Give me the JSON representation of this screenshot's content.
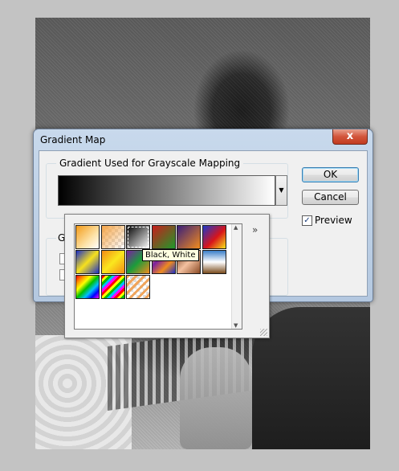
{
  "dialog": {
    "title": "Gradient Map",
    "close_label": "x",
    "group_label": "Gradient Used for Grayscale Mapping",
    "ok_label": "OK",
    "cancel_label": "Cancel",
    "preview_label": "Preview",
    "preview_checked": true,
    "options_group_partial_label": "G"
  },
  "picker": {
    "more_label": "»",
    "tooltip": "Black, White",
    "presets": [
      {
        "name": "orange-white",
        "css": "linear-gradient(135deg,#f39b1a 0%,#fde2a6 60%,#ffffff 100%)"
      },
      {
        "name": "orange-transparent",
        "css": "linear-gradient(135deg,#f5a64a 0%,rgba(245,166,74,0) 100%),repeating-conic-gradient(#ddd 0 25%,#fff 0 50%) 0 0/8px 8px"
      },
      {
        "name": "black-white",
        "css": "linear-gradient(135deg,#000 0%,#fff 100%)"
      },
      {
        "name": "red-green",
        "css": "linear-gradient(135deg,#c81d1d 0%,#1e9a2a 100%)"
      },
      {
        "name": "violet-orange",
        "css": "linear-gradient(135deg,#3a1f7a 0%,#f08b1e 100%)"
      },
      {
        "name": "blue-red-yellow",
        "css": "linear-gradient(135deg,#1b3acb 0%,#d8141a 55%,#f6e31a 100%)"
      },
      {
        "name": "blue-yellow-blue",
        "css": "linear-gradient(135deg,#1b2ec9 0%,#f6e11d 50%,#1b2ec9 100%)"
      },
      {
        "name": "orange-yellow-orange",
        "css": "linear-gradient(135deg,#f48b16 0%,#fae71e 50%,#f48b16 100%)"
      },
      {
        "name": "violet-green-orange",
        "css": "linear-gradient(135deg,#7b1fa2 0%,#1b9c3a 50%,#f08b1e 100%)"
      },
      {
        "name": "yellow-violet-orange-blue",
        "css": "linear-gradient(135deg,#f3e31a 0%,#7b1fa2 33%,#f08b1e 66%,#1b2ec9 100%)"
      },
      {
        "name": "copper",
        "css": "linear-gradient(135deg,#6b3317 0%,#f4c1a0 50%,#8a4a25 100%)"
      },
      {
        "name": "chrome",
        "css": "linear-gradient(180deg,#3b7fc9 0%,#ffffff 50%,#7a4c1e 100%)"
      },
      {
        "name": "spectrum",
        "css": "linear-gradient(135deg,#ff0000 0%,#ff8c00 17%,#ffff00 33%,#00c000 50%,#00bfff 67%,#0000ff 83%,#ff00ff 100%)"
      },
      {
        "name": "transparent-rainbow",
        "css": "repeating-linear-gradient(135deg,#ff0000 0 3px,#ffff00 3px 6px,#00c000 6px 9px,#00bfff 9px 12px,#ff00ff 12px 15px)"
      },
      {
        "name": "transparent-stripes",
        "css": "repeating-linear-gradient(135deg,#f0a45a 0 3px,rgba(255,255,255,0) 3px 7px),repeating-conic-gradient(#ddd 0 25%,#fff 0 50%) 0 0/8px 8px"
      }
    ]
  }
}
